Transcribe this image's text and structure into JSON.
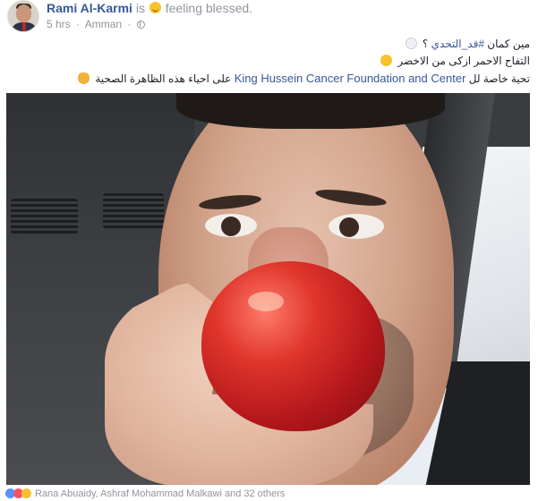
{
  "post": {
    "author_name": "Rami Al-Karmi",
    "is_text": "is",
    "feeling_emoji": "smiling-face-with-halo-icon",
    "feeling_text": "feeling blessed.",
    "time": "5 hrs",
    "separator": "·",
    "location": "Amman",
    "privacy_icon": "globe-icon"
  },
  "caption": {
    "line1_text": "مين كمان",
    "line1_hashtag": "#قد_التحدي",
    "line1_end": "؟",
    "line1_icon": "ghost-icon",
    "line2_text": "التفاح الاحمر ازكى من الاخضر",
    "line2_icon": "winking-tongue-icon",
    "line3_prefix": "تحية خاصة لل",
    "line3_link": "King Hussein Cancer Foundation and Center",
    "line3_suffix": "على احياء هذه الظاهرة الصحية",
    "line3_icon": "clapping-hands-icon"
  },
  "photo": {
    "subject": "man biting red apple in car"
  },
  "reactions": {
    "icons": [
      "like-icon",
      "love-icon",
      "haha-icon"
    ],
    "text": "Rana Abuaidy, Ashraf Mohammad Malkawi and 32 others"
  },
  "colors": {
    "link": "#365899",
    "meta": "#90949c",
    "text": "#1d2129"
  }
}
